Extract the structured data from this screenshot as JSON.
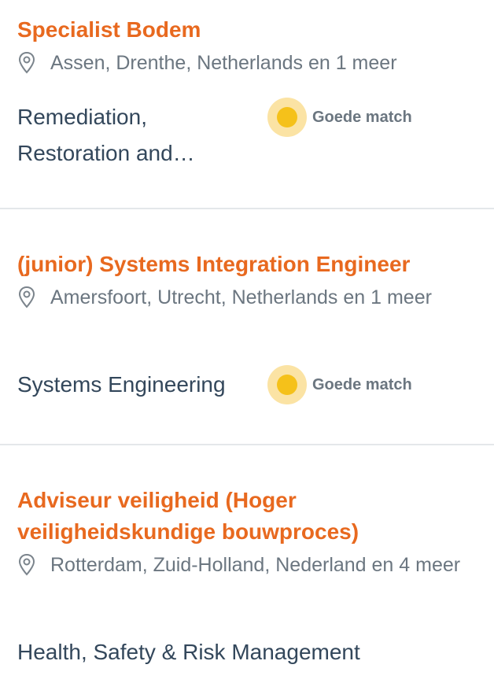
{
  "jobs": [
    {
      "title": "Specialist Bodem",
      "location": "Assen, Drenthe, Netherlands en 1 meer",
      "category": "Remediation, Restoration and…",
      "match": "Goede match"
    },
    {
      "title": "(junior) Systems Integration Engineer",
      "location": "Amersfoort, Utrecht, Netherlands en 1 meer",
      "category": "Systems Engineering",
      "match": "Goede match"
    },
    {
      "title": "Adviseur veiligheid (Hoger veiligheidskundige bouwproces)",
      "location": "Rotterdam, Zuid-Holland, Nederland en 4 meer",
      "category": "Health, Safety & Risk Management",
      "match": ""
    }
  ],
  "colors": {
    "title": "#e8691f",
    "location": "#6b7680",
    "category": "#33475b",
    "match_outer": "#fbe3a4",
    "match_inner": "#f5c11a",
    "divider": "#e4e7ea"
  },
  "icons": {
    "location": "map-pin-icon",
    "match": "match-indicator-dot"
  }
}
